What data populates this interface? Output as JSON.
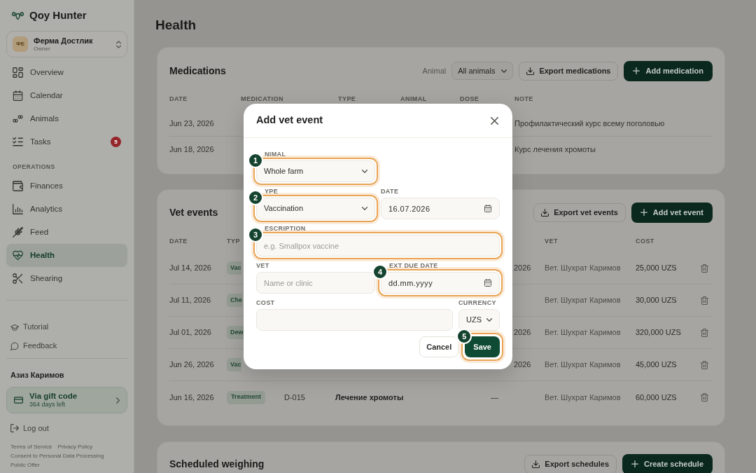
{
  "sidebar": {
    "brand": "Qoy Hunter",
    "farm": {
      "initials": "ФЕ",
      "name": "Ферма Достлик",
      "role": "Owner"
    },
    "nav_groups": [
      {
        "items": [
          {
            "label": "Overview",
            "selected": false
          },
          {
            "label": "Calendar",
            "selected": false
          },
          {
            "label": "Animals",
            "selected": false
          },
          {
            "label": "Tasks",
            "selected": false,
            "badge": "5"
          }
        ]
      },
      {
        "heading": "OPERATIONS",
        "items": [
          {
            "label": "Finances",
            "selected": false
          },
          {
            "label": "Analytics",
            "selected": false
          },
          {
            "label": "Feed",
            "selected": false
          },
          {
            "label": "Health",
            "selected": true
          },
          {
            "label": "Shearing",
            "selected": false
          }
        ]
      }
    ],
    "help_links": [
      {
        "label": "Tutorial"
      },
      {
        "label": "Feedback"
      }
    ],
    "user_name": "Азиз Каримов",
    "plan": {
      "title": "Via gift code",
      "subtitle": "364 days left"
    },
    "logout": "Log out",
    "legal_links": [
      "Terms of Service",
      "Privacy Policy",
      "Consent to Personal Data Processing",
      "Public Offer"
    ]
  },
  "page": {
    "title": "Health"
  },
  "medications": {
    "title": "Medications",
    "filter": {
      "label": "Animal",
      "value": "All animals"
    },
    "actions": [
      {
        "kind": "export",
        "label": "Export medications"
      },
      {
        "kind": "add",
        "label": "Add medication"
      }
    ],
    "columns": [
      "DATE",
      "MEDICATION",
      "TYPE",
      "ANIMAL",
      "DOSE",
      "NOTE"
    ],
    "rows": [
      {
        "date": "Jun 23, 2026",
        "note": "Профилактический курс всему поголовью"
      },
      {
        "date": "Jun 18, 2026",
        "note": "Курс лечения хромоты"
      }
    ]
  },
  "vet_events": {
    "title": "Vet events",
    "actions": [
      {
        "kind": "export",
        "label": "Export vet events"
      },
      {
        "kind": "add",
        "label": "Add vet event"
      }
    ],
    "header": {
      "date": "DATE",
      "type": "TYP",
      "vet": "VET",
      "cost": "COST"
    },
    "rows": [
      {
        "date": "Jul 14, 2026",
        "type": {
          "text": "Vac",
          "clipped": true
        },
        "column_5_tail": "2026",
        "vet": "Вет. Шухрат Каримов",
        "cost": "25,000 UZS"
      },
      {
        "date": "Jul 11, 2026",
        "type": {
          "text": "Che",
          "clipped": true
        },
        "vet": "Вет. Шухрат Каримов",
        "cost": "30,000 UZS"
      },
      {
        "date": "Jul 01, 2026",
        "type": {
          "text": "Dew",
          "clipped": true
        },
        "column_5_tail": "2026",
        "vet": "Вет. Шухрат Каримов",
        "cost": "320,000 UZS"
      },
      {
        "date": "Jun 26, 2026",
        "type": {
          "text": "Vac",
          "clipped": true
        },
        "column_5_tail": "2026",
        "vet": "Вет. Шухрат Каримов",
        "cost": "45,000 UZS"
      },
      {
        "date": "Jun 16, 2026",
        "type": {
          "text": "Treatment",
          "clipped": false
        },
        "column_3": "D-015",
        "column_4": "Лечение хромоты",
        "column_5": "—",
        "vet": "Вет. Шухрат Каримов",
        "cost": "60,000 UZS"
      }
    ]
  },
  "scheduled_weighing": {
    "title": "Scheduled weighing",
    "actions": [
      {
        "kind": "export",
        "label": "Export schedules"
      },
      {
        "kind": "add",
        "label": "Create schedule"
      }
    ]
  },
  "dialog": {
    "title": "Add vet event",
    "rows": [
      {
        "kind": "half",
        "fields": [
          {
            "kind": "select",
            "label": "NIMAL",
            "value": "Whole farm",
            "callout": "1"
          }
        ]
      },
      {
        "kind": "half",
        "fields": [
          {
            "kind": "select",
            "label": "YPE",
            "value": "Vaccination",
            "callout": "2"
          },
          {
            "kind": "date",
            "label": "DATE",
            "value": "16.07.2026"
          }
        ]
      },
      {
        "kind": "full",
        "fields": [
          {
            "kind": "text",
            "label": "ESCRIPTION",
            "placeholder": "e.g. Smallpox vaccine",
            "callout": "3"
          }
        ]
      },
      {
        "kind": "half",
        "fields": [
          {
            "kind": "text",
            "label": "VET",
            "placeholder": "Name or clinic"
          },
          {
            "kind": "date",
            "label": "EXT DUE DATE",
            "placeholder": "dd.mm.yyyy",
            "callout": "4"
          }
        ]
      },
      {
        "kind": "main-side",
        "fields": [
          {
            "kind": "text",
            "label": "COST"
          },
          {
            "kind": "select",
            "label": "CURRENCY",
            "value": "UZS"
          }
        ]
      }
    ],
    "buttons": [
      {
        "kind": "secondary",
        "label": "Cancel"
      },
      {
        "kind": "primary",
        "label": "Save",
        "callout": "5"
      }
    ]
  }
}
